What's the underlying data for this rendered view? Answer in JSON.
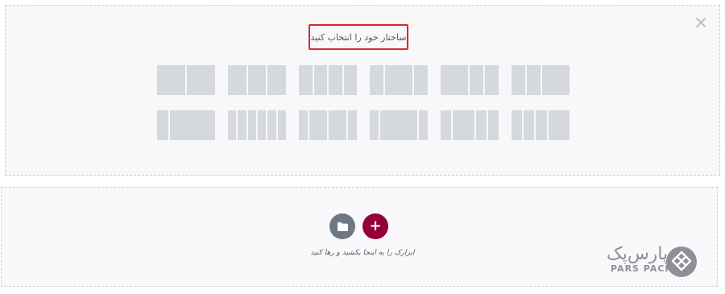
{
  "structure_panel": {
    "title": "ساختار خود را انتخاب کنید",
    "close_symbol": "✕",
    "rows": [
      [
        [
          1,
          1
        ],
        [
          1,
          1,
          1
        ],
        [
          1,
          1,
          1,
          1
        ],
        [
          1,
          2,
          1
        ],
        [
          2,
          1,
          1
        ],
        [
          1,
          1,
          2
        ]
      ],
      [
        [
          1,
          4
        ],
        [
          1,
          1,
          1,
          1,
          1,
          1
        ],
        [
          1,
          2,
          2,
          1
        ],
        [
          1,
          4,
          1
        ],
        [
          1,
          2,
          1,
          1
        ],
        [
          1,
          1,
          1,
          2
        ]
      ]
    ]
  },
  "drop_zone": {
    "instruction": "ابزارک را به اینجا بکشید و رها کنید",
    "add_symbol": "+",
    "folder_icon": "folder-icon"
  },
  "logo": {
    "name_fa": "پارس‌پک",
    "name_en": "PARS PACK"
  },
  "colors": {
    "highlight": "#d9292d",
    "add_button": "#93003a",
    "folder_button": "#6d7882",
    "preset_cell": "#d5d8dc"
  }
}
